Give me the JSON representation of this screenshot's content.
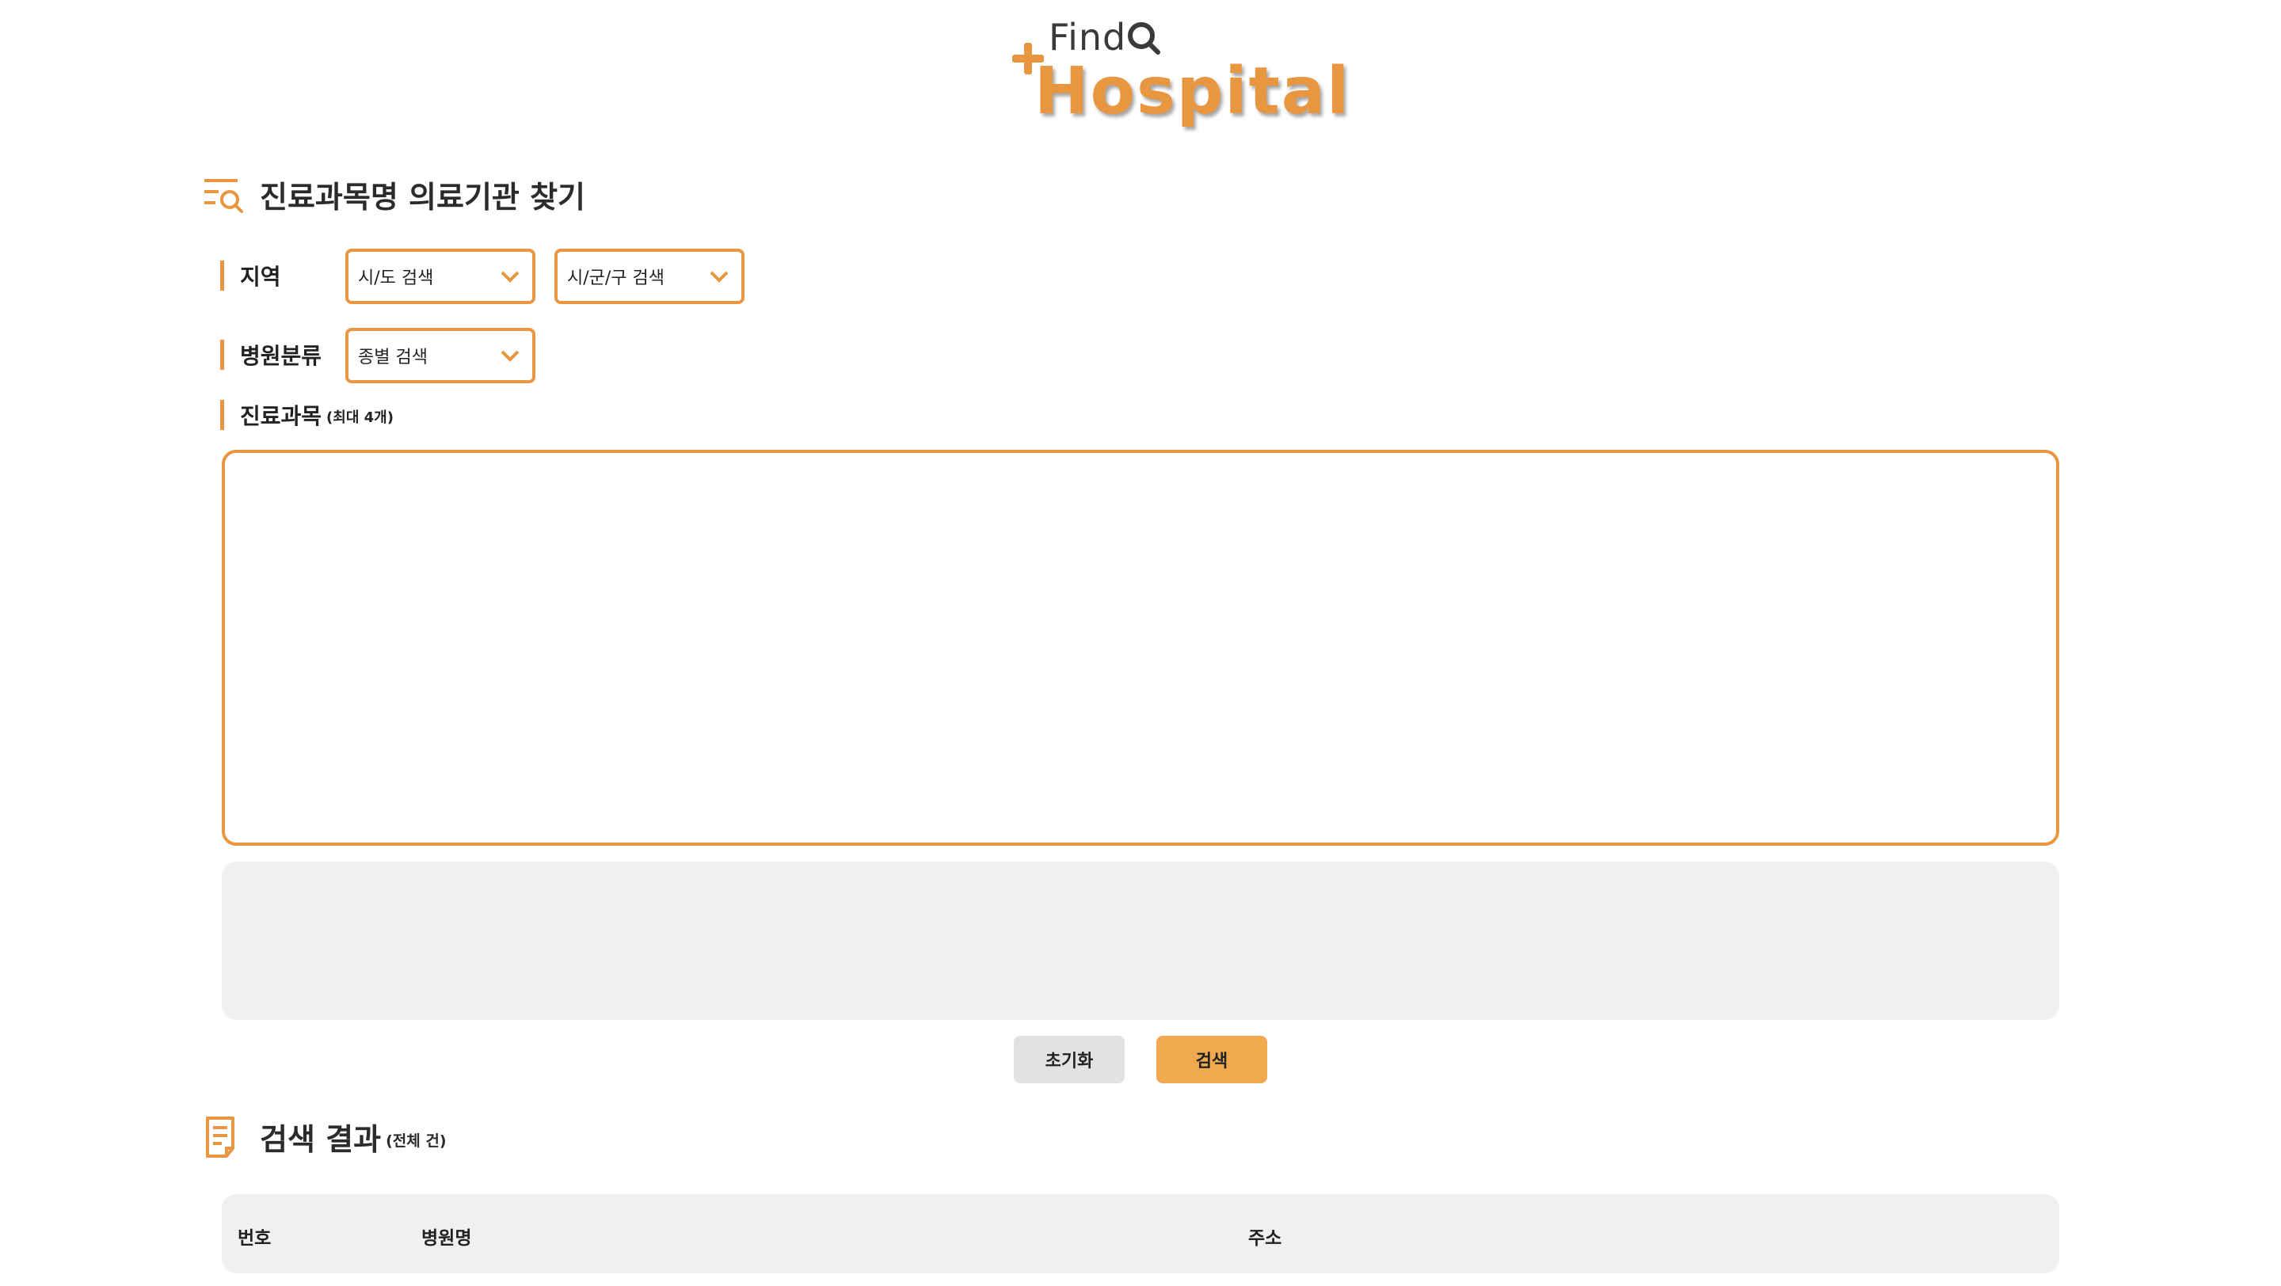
{
  "logo": {
    "line1": "Find",
    "line2": "Hospital"
  },
  "search_section": {
    "title": "진료과목명 의료기관 찾기",
    "region_label": "지역",
    "region_sido_value": "시/도 검색",
    "region_sigungu_value": "시/군/구 검색",
    "category_label": "병원분류",
    "category_value": "종별 검색",
    "department_label": "진료과목",
    "department_hint": "(최대 4개)"
  },
  "buttons": {
    "reset_label": "초기화",
    "search_label": "검색"
  },
  "results_section": {
    "title": "검색 결과",
    "count_hint": "(전체 건)",
    "columns": [
      "번호",
      "병원명",
      "주소"
    ]
  },
  "colors": {
    "accent": "#E8963F",
    "search_button": "#F1A94F",
    "reset_button": "#E2E2E2",
    "panel_bg": "#F0F0F0"
  },
  "icons": {
    "search_list_icon": "list-search-icon",
    "results_icon": "document-icon",
    "chevron": "chevron-down-icon"
  }
}
